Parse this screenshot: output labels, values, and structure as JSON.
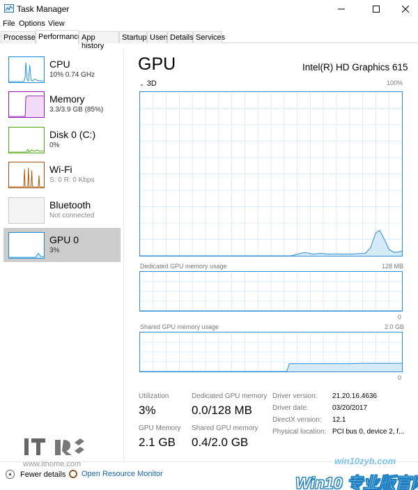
{
  "window": {
    "title": "Task Manager"
  },
  "menu": {
    "items": [
      "File",
      "Options",
      "View"
    ]
  },
  "tabs": [
    "Processes",
    "Performance",
    "App history",
    "Startup",
    "Users",
    "Details",
    "Services"
  ],
  "active_tab": 1,
  "sidebar": [
    {
      "name": "CPU",
      "sub": "10%  0.74 GHz",
      "color": "#1a8cd8",
      "level": 0.1
    },
    {
      "name": "Memory",
      "sub": "3.3/3.9 GB (85%)",
      "color": "#8b15b3",
      "level": 0.85
    },
    {
      "name": "Disk 0 (C:)",
      "sub": "0%",
      "color": "#4da60c",
      "level": 0.0
    },
    {
      "name": "Wi-Fi",
      "sub": "S: 0  R: 0 Kbps",
      "color": "#a74f01",
      "level": 0.0
    },
    {
      "name": "Bluetooth",
      "sub": "Not connected",
      "color": "#b0b0b0",
      "level": 0.0
    },
    {
      "name": "GPU 0",
      "sub": "3%",
      "color": "#1a8cd8",
      "level": 0.03
    }
  ],
  "gpu": {
    "title": "GPU",
    "model": "Intel(R) HD Graphics 615",
    "engine": "3D",
    "main_max": "100%",
    "dedicated_label": "Dedicated GPU memory usage",
    "dedicated_max": "128 MB",
    "dedicated_min": "0",
    "shared_label": "Shared GPU memory usage",
    "shared_max": "2.0 GB",
    "shared_min": "0"
  },
  "stats": {
    "utilization_label": "Utilization",
    "utilization": "3%",
    "dedicated_label": "Dedicated GPU memory",
    "dedicated": "0.0/128 MB",
    "gpu_memory_label": "GPU Memory",
    "gpu_memory": "2.1 GB",
    "shared_label": "Shared GPU memory",
    "shared": "0.4/2.0 GB"
  },
  "info": [
    {
      "label": "Driver version:",
      "value": "21.20.16.4636"
    },
    {
      "label": "Driver date:",
      "value": "03/20/2017"
    },
    {
      "label": "DirectX version:",
      "value": "12.1"
    },
    {
      "label": "Physical location:",
      "value": "PCI bus 0, device 2, f..."
    }
  ],
  "footer": {
    "fewer": "Fewer details",
    "resource_monitor": "Open Resource Monitor"
  },
  "watermarks": {
    "ithome_url": "www.ithome.com",
    "site": "win10zyb.com",
    "brand": "Win10 专业版官网"
  },
  "colors": {
    "accent": "#2c8cd8",
    "graph_fill": "#d6ebfa",
    "grid": "#d8ecf8"
  }
}
